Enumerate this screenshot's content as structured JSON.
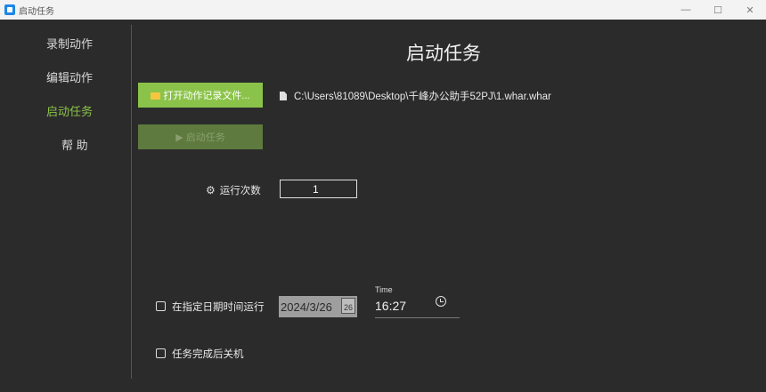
{
  "window": {
    "title": "启动任务",
    "minimize": "—",
    "maximize": "☐",
    "close": "✕"
  },
  "sidebar": {
    "items": [
      {
        "label": "录制动作"
      },
      {
        "label": "编辑动作"
      },
      {
        "label": "启动任务"
      },
      {
        "label": "帮 助"
      }
    ]
  },
  "main": {
    "title": "启动任务",
    "open_file_label": "打开动作记录文件...",
    "file_path": "C:\\Users\\81089\\Desktop\\千峰办公助手52PJ\\1.whar.whar",
    "start_label": "▶ 启动任务",
    "run_count_label": "运行次数",
    "run_count_value": "1",
    "scheduled_label": "在指定日期时间运行",
    "date_value": "2024/3/26",
    "calendar_day": "26",
    "time_label": "Time",
    "time_value": "16:27",
    "shutdown_label": "任务完成后关机"
  },
  "colors": {
    "accent": "#8bc34a",
    "background": "#2b2b2b"
  }
}
